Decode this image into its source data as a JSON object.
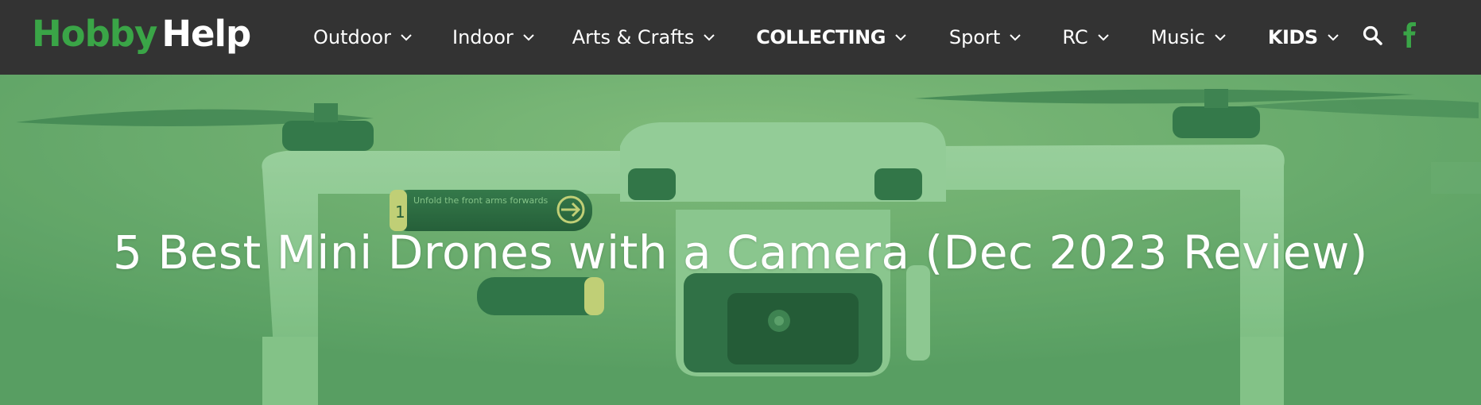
{
  "brand": {
    "logo_part1": "Hobby",
    "logo_part2": "Help",
    "logo_green": "#3aa547",
    "nav_background": "#333333"
  },
  "nav": {
    "items": [
      {
        "label": "Outdoor",
        "bold": false
      },
      {
        "label": "Indoor",
        "bold": false
      },
      {
        "label": "Arts & Crafts",
        "bold": false
      },
      {
        "label": "COLLECTING",
        "bold": true
      },
      {
        "label": "Sport",
        "bold": false
      },
      {
        "label": "RC",
        "bold": false
      },
      {
        "label": "Music",
        "bold": false
      },
      {
        "label": "KIDS",
        "bold": true
      }
    ],
    "dropdown_icon": "chevron-down-icon",
    "search_icon": "search-icon",
    "social_icon": "facebook-icon",
    "social_color": "#3aa547"
  },
  "hero": {
    "title": "5 Best Mini Drones with a Camera (Dec 2023 Review)",
    "drone_label": "Unfold the  front arms forwards",
    "drone_label_number": "1",
    "image_subject": "mini drone"
  }
}
